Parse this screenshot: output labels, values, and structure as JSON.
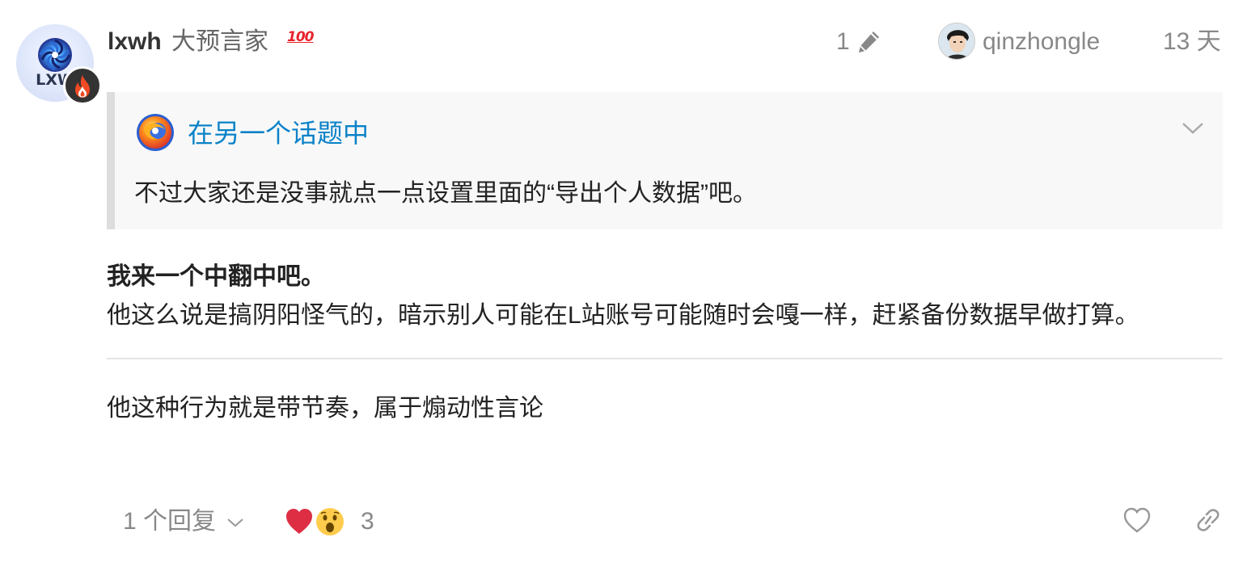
{
  "post": {
    "author": {
      "username": "lxwh",
      "title": "大预言家",
      "badge": "100",
      "avatar_text": "LXW",
      "avatar_icon": "swirl-logo-icon",
      "flair_icon": "flame-icon"
    },
    "meta": {
      "edit_count": "1",
      "edit_icon": "pencil-icon",
      "reply_to_user": "qinzhongle",
      "date": "13 天"
    },
    "quote": {
      "title": "在另一个话题中",
      "text": "不过大家还是没事就点一点设置里面的“导出个人数据”吧。",
      "expand_icon": "chevron-down-icon"
    },
    "body": {
      "bold_line": "我来一个中翻中吧。",
      "line1": "他这么说是搞阴阳怪气的，暗示别人可能在L站账号可能随时会嘎一样，赶紧备份数据早做打算。",
      "line2": "他这种行为就是带节奏，属于煽动性言论"
    },
    "actions": {
      "replies_label": "1 个回复",
      "reactions": [
        "heart-emoji",
        "open-mouth-emoji"
      ],
      "reactions_count": "3",
      "like_icon": "heart-outline-icon",
      "share_icon": "link-icon"
    },
    "colors": {
      "link": "#0a82c8",
      "muted": "#888888",
      "badge": "#e8232c",
      "quote_bg": "#f8f8f8",
      "quote_border": "#dddddd"
    }
  }
}
